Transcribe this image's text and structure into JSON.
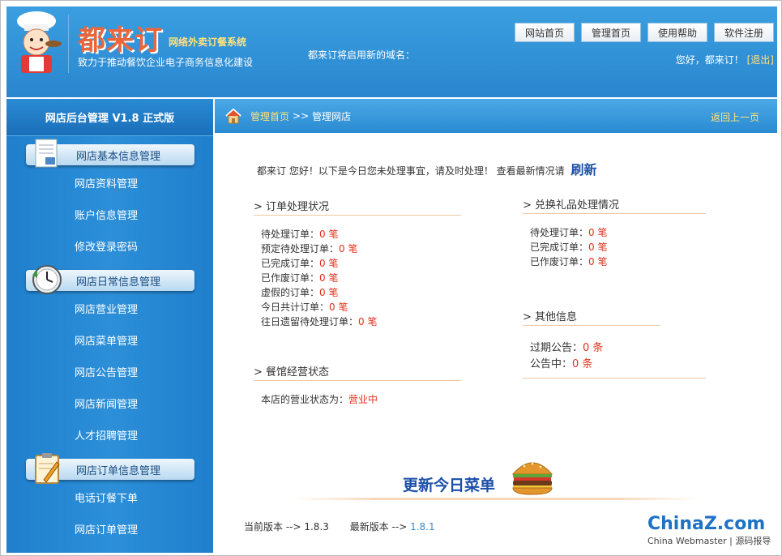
{
  "header": {
    "brand": "都来订",
    "brand_sub": "网络外卖订餐系统",
    "slogan": "致力于推动餐饮企业电子商务信息化建设",
    "domain_note": "都来订将启用新的域名：",
    "nav": [
      "网站首页",
      "管理首页",
      "使用帮助",
      "软件注册"
    ],
    "greeting": "您好，都来订！",
    "logout": "[退出]"
  },
  "sidebar": {
    "title": "网店后台管理 V1.8 正式版",
    "groups": [
      {
        "label": "网店基本信息管理",
        "icon": "document-icon",
        "items": [
          "网店资料管理",
          "账户信息管理",
          "修改登录密码"
        ]
      },
      {
        "label": "网店日常信息管理",
        "icon": "clock-icon",
        "items": [
          "网店营业管理",
          "网店菜单管理",
          "网店公告管理",
          "网店新闻管理",
          "人才招聘管理"
        ]
      },
      {
        "label": "网店订单信息管理",
        "icon": "clipboard-icon",
        "items": [
          "电话订餐下单",
          "网店订单管理"
        ]
      }
    ]
  },
  "breadcrumb": {
    "home": "管理首页",
    "sep": ">>",
    "current": "管理网店",
    "back": "返回上一页"
  },
  "intro": {
    "text": "都来订 您好！以下是今日您未处理事宜，请及时处理！ 查看最新情况请",
    "refresh": "刷新"
  },
  "orders": {
    "title": "> 订单处理状况",
    "rows": [
      {
        "label": "待处理订单：",
        "value": "0 笔"
      },
      {
        "label": "预定待处理订单：",
        "value": "0 笔"
      },
      {
        "label": "已完成订单：",
        "value": "0 笔"
      },
      {
        "label": "已作废订单：",
        "value": "0 笔"
      },
      {
        "label": "虚假的订单：",
        "value": "0 笔"
      },
      {
        "label": "今日共计订单：",
        "value": "0 笔"
      },
      {
        "label": "往日遗留待处理订单：",
        "value": "0 笔"
      }
    ]
  },
  "gifts": {
    "title": "> 兑换礼品处理情况",
    "rows": [
      {
        "label": "待处理订单：",
        "value": "0 笔"
      },
      {
        "label": "已完成订单：",
        "value": "0 笔"
      },
      {
        "label": "已作废订单：",
        "value": "0 笔"
      }
    ]
  },
  "other": {
    "title": "> 其他信息",
    "rows": [
      {
        "label": "过期公告：",
        "value": "0 条"
      },
      {
        "label": "公告中：",
        "value": "0 条"
      }
    ]
  },
  "status": {
    "title": "> 餐馆经营状态",
    "label": "本店的营业状态为：",
    "value": "营业中"
  },
  "update_menu": "更新今日菜单",
  "version": {
    "current_label": "当前版本 -->",
    "current": "1.8.3",
    "latest_label": "最新版本 -->",
    "latest": "1.8.1"
  },
  "watermark": {
    "line1": "ChinaZ.com",
    "line2": "China Webmaster | 源码报导"
  },
  "colors": {
    "header_blue": "#2a86cf",
    "accent_yellow": "#ffe27a",
    "value_red": "#e0321c",
    "link_blue": "#1b4fa8"
  }
}
